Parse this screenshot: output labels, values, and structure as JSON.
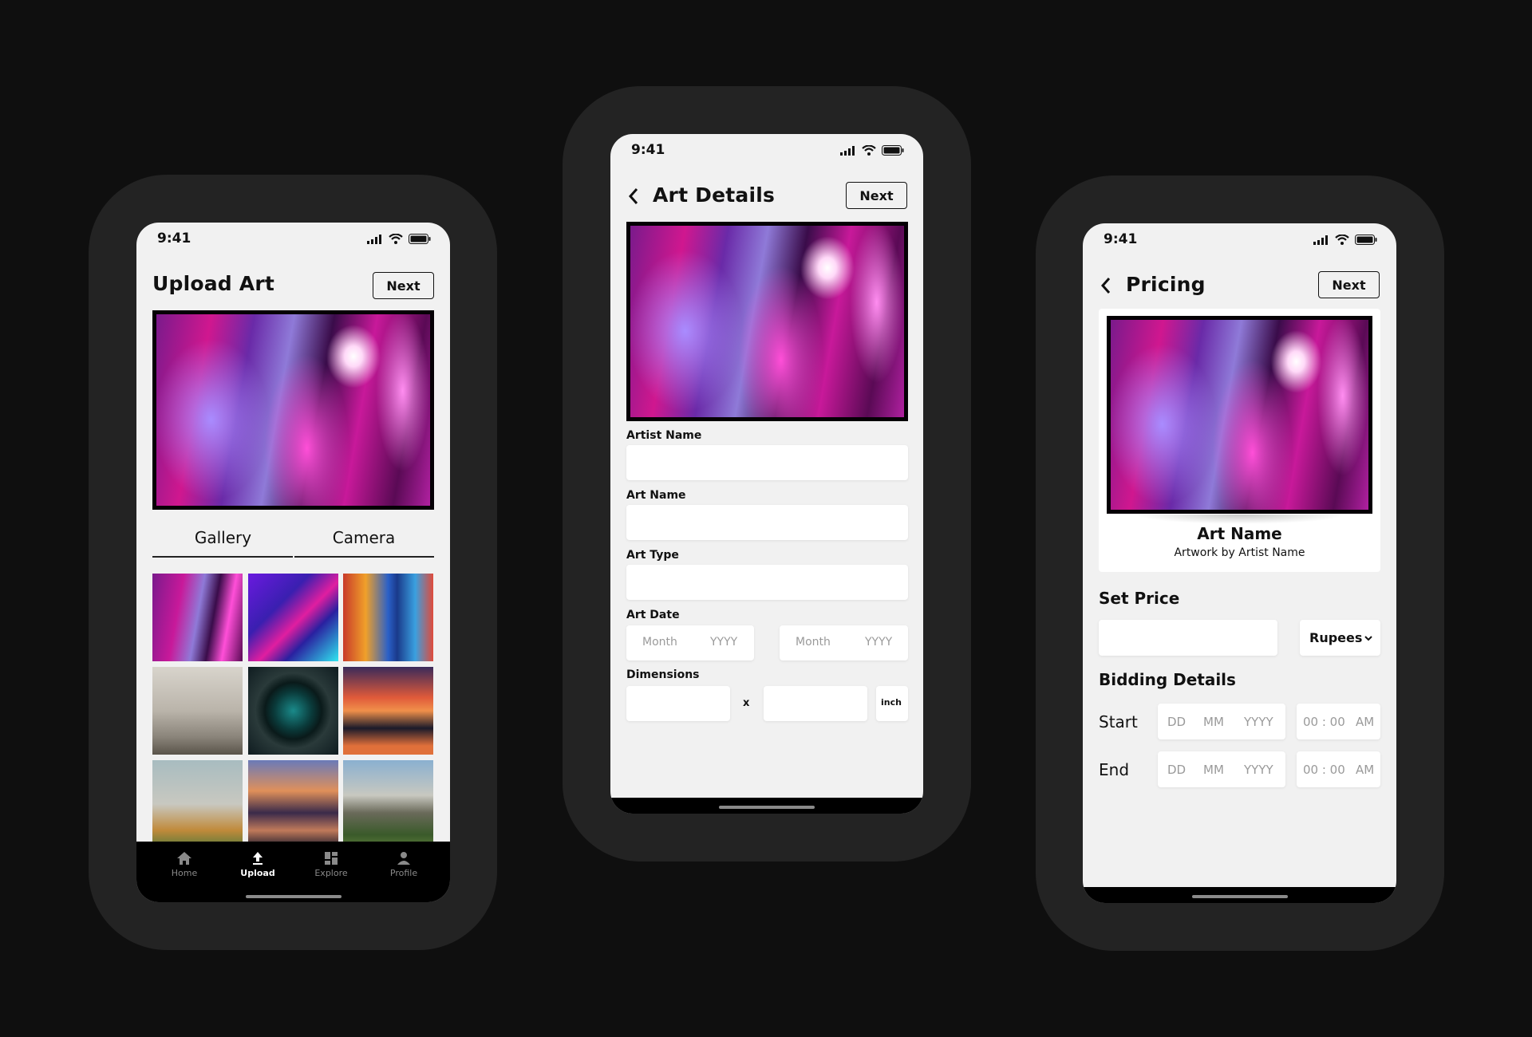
{
  "status": {
    "time": "9:41"
  },
  "upload": {
    "title": "Upload Art",
    "next": "Next",
    "tabs": {
      "gallery": "Gallery",
      "camera": "Camera"
    },
    "nav": {
      "home": "Home",
      "upload": "Upload",
      "explore": "Explore",
      "profile": "Profile"
    }
  },
  "details": {
    "title": "Art Details",
    "next": "Next",
    "fields": {
      "artist_name": "Artist Name",
      "art_name": "Art Name",
      "art_type": "Art Type",
      "art_date": "Art Date",
      "dimensions": "Dimensions"
    },
    "date_ph": {
      "month": "Month",
      "year": "YYYY"
    },
    "dim_x": "x",
    "dim_unit": "inch"
  },
  "pricing": {
    "title": "Pricing",
    "next": "Next",
    "art_name": "Art Name",
    "art_by": "Artwork by Artist Name",
    "set_price": "Set Price",
    "currency": "Rupees",
    "bidding": "Bidding Details",
    "start": "Start",
    "end": "End",
    "ph": {
      "dd": "DD",
      "mm": "MM",
      "yyyy": "YYYY",
      "time": "00 : 00",
      "ampm": "AM"
    }
  }
}
